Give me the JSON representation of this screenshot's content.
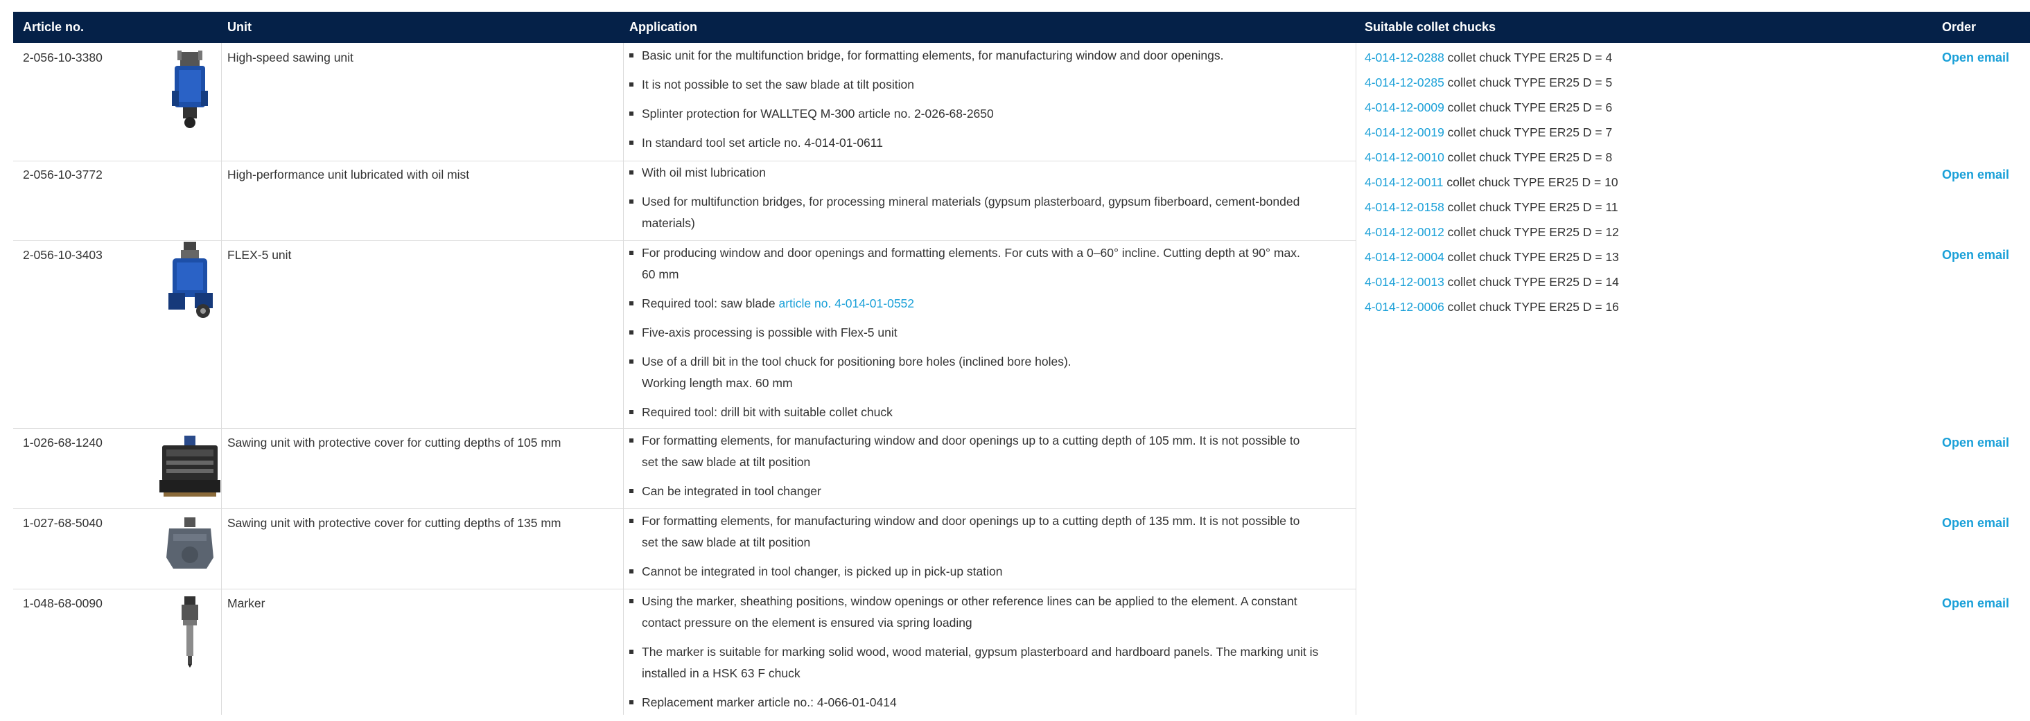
{
  "header": {
    "article_no": "Article no.",
    "unit": "Unit",
    "application": "Application",
    "chucks": "Suitable collet chucks",
    "order": "Order"
  },
  "rows": [
    {
      "article_no": "2-056-10-3380",
      "unit": "High-speed sawing unit",
      "image_icon": "sawing-unit-image",
      "applications": [
        [
          "Basic unit for the multifunction bridge, for formatting elements, for manufacturing window and door openings."
        ],
        [
          "It is not possible to set the saw blade at tilt position"
        ],
        [
          "Splinter protection for WALLTEQ M-300 article no. 2-026-68-2650"
        ],
        [
          "In standard tool set article no. 4-014-01-0611"
        ]
      ],
      "order": "Open email"
    },
    {
      "article_no": "2-056-10-3772",
      "unit": "High-performance unit lubricated with oil mist",
      "applications": [
        [
          "With oil mist lubrication"
        ],
        [
          "Used for multifunction bridges, for processing mineral materials (gypsum plasterboard, gypsum fiberboard, cement-bonded",
          "materials)"
        ]
      ],
      "order": "Open email"
    },
    {
      "article_no": "2-056-10-3403",
      "unit": "FLEX-5 unit",
      "image_icon": "flex5-unit-image",
      "applications": [
        [
          "For producing window and door openings and formatting elements. For cuts with a 0–60° incline. Cutting depth at 90° max.",
          "60 mm"
        ],
        [
          "Required tool: saw blade "
        ],
        [
          "Five-axis processing is possible with Flex-5 unit"
        ],
        [
          "Use of a drill bit in the tool chuck for positioning bore holes (inclined bore holes).",
          "Working length max. 60 mm"
        ],
        [
          "Required tool: drill bit with suitable collet chuck"
        ]
      ],
      "saw_blade_link": "article no. 4-014-01-0552",
      "order": "Open email"
    },
    {
      "article_no": "1-026-68-1240",
      "unit": "Sawing unit with protective cover for cutting depths of 105 mm",
      "image_icon": "sawing-unit-105-image",
      "applications": [
        [
          "For formatting elements, for manufacturing window and door openings up to a cutting depth of 105 mm.  It is not possible to",
          "set the saw blade at tilt position"
        ],
        [
          "Can be integrated in tool changer"
        ]
      ],
      "order": "Open email"
    },
    {
      "article_no": "1-027-68-5040",
      "unit": "Sawing unit with protective cover for cutting depths of 135 mm",
      "image_icon": "sawing-unit-135-image",
      "applications": [
        [
          "For formatting elements, for manufacturing window and door openings up to a cutting depth of 135 mm.  It is not possible to",
          "set the saw blade at tilt position"
        ],
        [
          "Cannot be integrated in tool changer, is picked up in pick-up station"
        ]
      ],
      "order": "Open email"
    },
    {
      "article_no": "1-048-68-0090",
      "unit": "Marker",
      "image_icon": "marker-unit-image",
      "applications": [
        [
          "Using the marker, sheathing positions, window openings or other reference lines can be applied to the element. A constant",
          "contact pressure on the element is ensured via spring loading"
        ],
        [
          "The marker is suitable for marking solid wood, wood material, gypsum plasterboard and hardboard panels. The marking unit is",
          "installed in a HSK 63 F chuck"
        ],
        [
          "Replacement marker article no.: 4-066-01-0414"
        ]
      ],
      "order": "Open email"
    }
  ],
  "collet_chucks": [
    {
      "code": "4-014-12-0288",
      "text": " collet chuck TYPE ER25 D = 4"
    },
    {
      "code": "4-014-12-0285",
      "text": " collet chuck TYPE ER25 D = 5"
    },
    {
      "code": "4-014-12-0009",
      "text": " collet chuck TYPE ER25 D = 6"
    },
    {
      "code": "4-014-12-0019",
      "text": " collet chuck TYPE ER25 D = 7"
    },
    {
      "code": "4-014-12-0010",
      "text": " collet chuck TYPE ER25 D = 8"
    },
    {
      "code": "4-014-12-0011",
      "text": " collet chuck TYPE ER25 D = 10"
    },
    {
      "code": "4-014-12-0158",
      "text": " collet chuck TYPE ER25 D = 11"
    },
    {
      "code": "4-014-12-0012",
      "text": " collet chuck TYPE ER25 D = 12"
    },
    {
      "code": "4-014-12-0004",
      "text": " collet chuck TYPE ER25 D = 13"
    },
    {
      "code": "4-014-12-0013",
      "text": " collet chuck TYPE ER25 D = 14"
    },
    {
      "code": "4-014-12-0006",
      "text": " collet chuck TYPE ER25 D = 16"
    }
  ],
  "colors": {
    "header_bg": "#052148",
    "link": "#1aa0d8",
    "divider": "#dcdcdc"
  }
}
